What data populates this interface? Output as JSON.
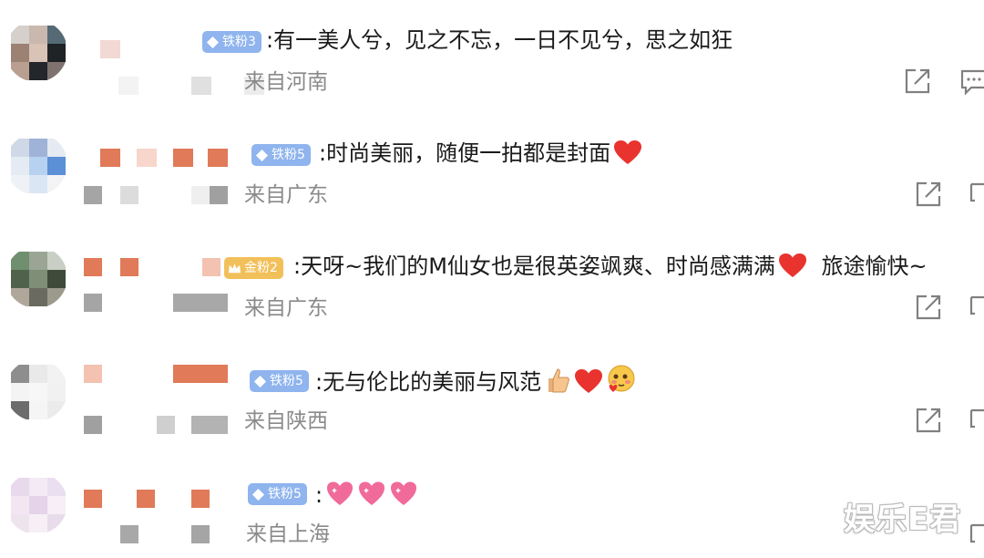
{
  "comments": [
    {
      "badge": "铁粉3",
      "text": ":有一美人兮，见之不忘，一日不见兮，思之如狂",
      "location": "来自河南"
    },
    {
      "badge": "铁粉5",
      "text": ":时尚美丽，随便一拍都是封面",
      "location": "来自广东"
    },
    {
      "badge": "金粉2",
      "text": ":天呀~我们的M仙女也是很英姿飒爽、时尚感满满",
      "text_tail": "旅途愉快~",
      "location": "来自广东"
    },
    {
      "badge": "铁粉5",
      "text": ":无与伦比的美丽与风范",
      "location": "来自陕西"
    },
    {
      "badge": "铁粉5",
      "text": ":",
      "location": "来自上海"
    }
  ],
  "watermark": "娱乐E君",
  "icons": {
    "share": "share-icon",
    "reply": "comment-icon",
    "heart": "red-heart-emoji",
    "sparkle_heart": "pink-sparkling-heart-emoji",
    "thumbs": "thumbs-up-emoji",
    "blush": "blushing-face-emoji"
  },
  "colors": {
    "badge_blue": "#8fb4ee",
    "badge_gold": "#f2c05a",
    "location_gray": "#8a8a8a",
    "heart_red": "#e8332e"
  }
}
